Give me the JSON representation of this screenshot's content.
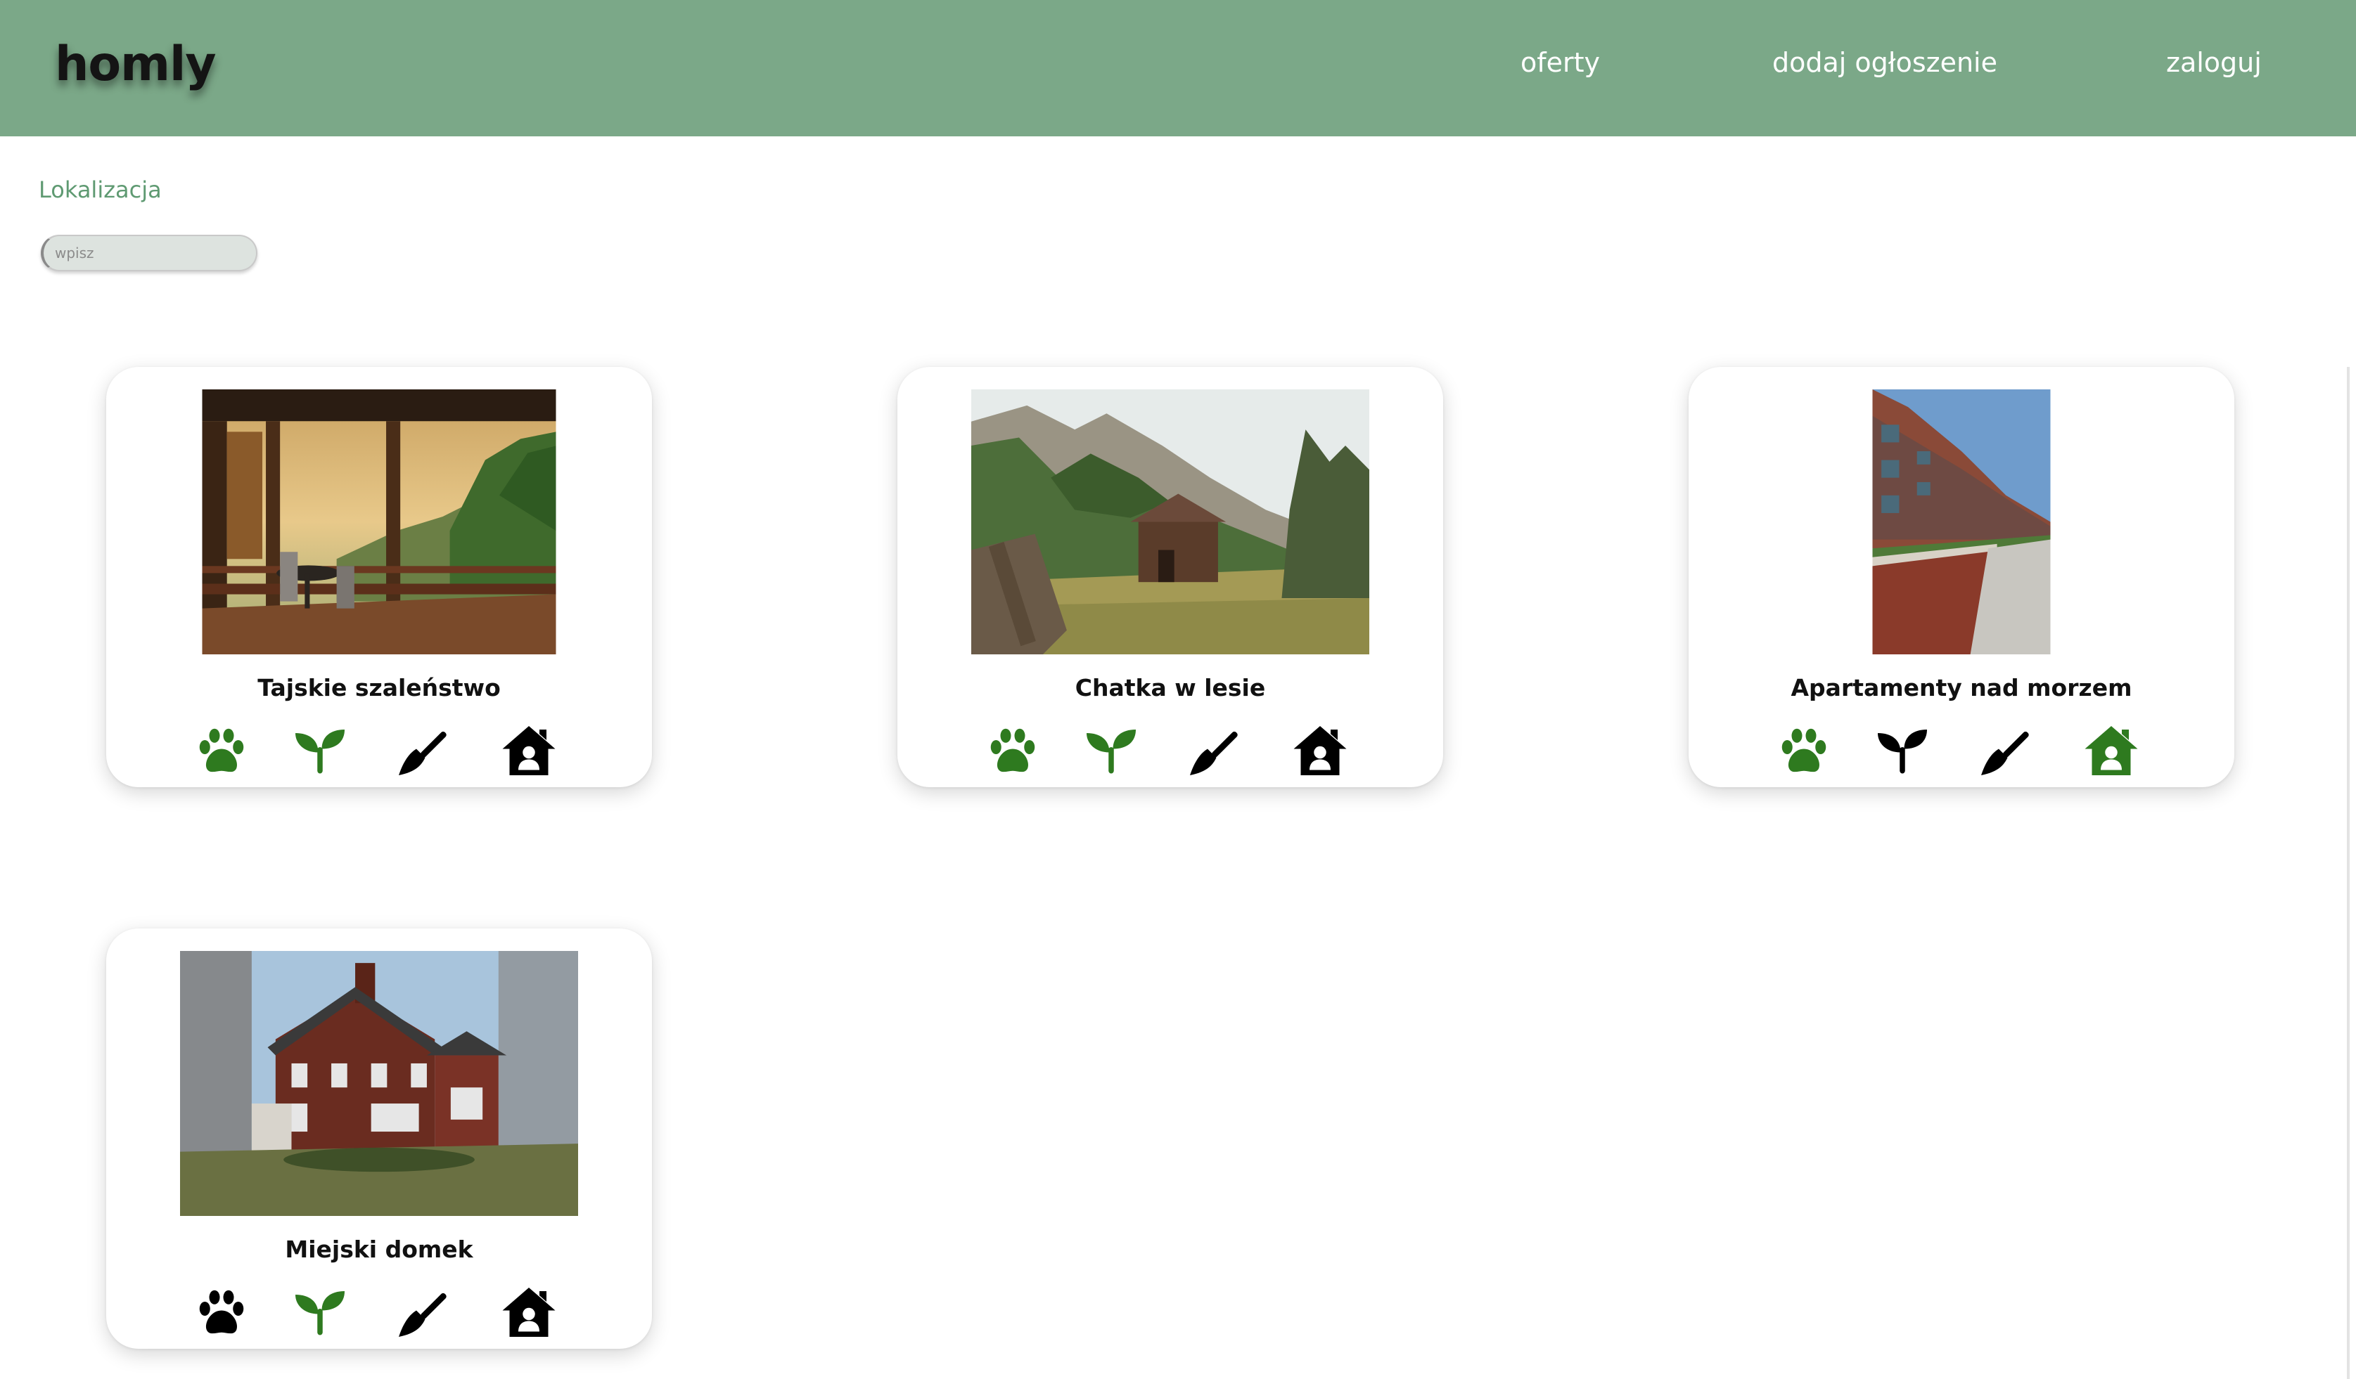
{
  "header": {
    "logo": "homly",
    "nav": {
      "offers": "oferty",
      "add_listing": "dodaj ogłoszenie",
      "login": "zaloguj"
    }
  },
  "filters": {
    "location_label": "Lokalizacja",
    "location_placeholder": "wpisz",
    "location_value": ""
  },
  "colors": {
    "header_bg": "#7ba888",
    "accent_text": "#5f9a72",
    "amenity_active": "#2e7a1f",
    "amenity_inactive": "#000000"
  },
  "listings": [
    {
      "title": "Tajskie szaleństwo",
      "photo": "covered veranda with table and chairs overlooking jungle at sunset",
      "amenities": [
        {
          "icon": "paw-icon",
          "meaning": "pets",
          "active": true
        },
        {
          "icon": "sprout-icon",
          "meaning": "eco",
          "active": true
        },
        {
          "icon": "broom-icon",
          "meaning": "cleaning",
          "active": false
        },
        {
          "icon": "house-user-icon",
          "meaning": "whole house",
          "active": false
        }
      ]
    },
    {
      "title": "Chatka w lesie",
      "photo": "log cabin in a mountain meadow",
      "amenities": [
        {
          "icon": "paw-icon",
          "meaning": "pets",
          "active": true
        },
        {
          "icon": "sprout-icon",
          "meaning": "eco",
          "active": true
        },
        {
          "icon": "broom-icon",
          "meaning": "cleaning",
          "active": false
        },
        {
          "icon": "house-user-icon",
          "meaning": "whole house",
          "active": false
        }
      ]
    },
    {
      "title": "Apartamenty nad morzem",
      "photo": "modern apartment block with brick wall and promenade",
      "amenities": [
        {
          "icon": "paw-icon",
          "meaning": "pets",
          "active": true
        },
        {
          "icon": "sprout-icon",
          "meaning": "eco",
          "active": false
        },
        {
          "icon": "broom-icon",
          "meaning": "cleaning",
          "active": false
        },
        {
          "icon": "house-user-icon",
          "meaning": "whole house",
          "active": true
        }
      ]
    },
    {
      "title": "Miejski domek",
      "photo": "red brick two-storey house among bare trees",
      "amenities": [
        {
          "icon": "paw-icon",
          "meaning": "pets",
          "active": false
        },
        {
          "icon": "sprout-icon",
          "meaning": "eco",
          "active": true
        },
        {
          "icon": "broom-icon",
          "meaning": "cleaning",
          "active": false
        },
        {
          "icon": "house-user-icon",
          "meaning": "whole house",
          "active": false
        }
      ]
    }
  ]
}
